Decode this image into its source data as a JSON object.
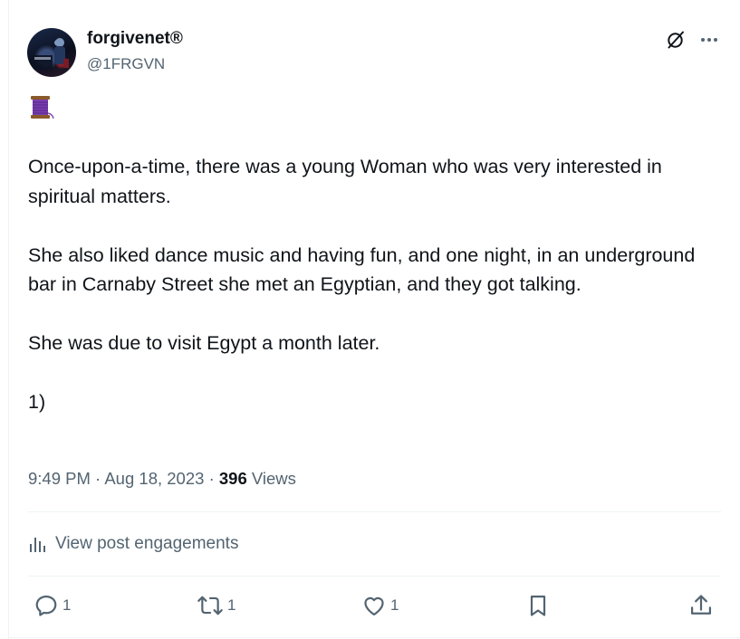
{
  "post": {
    "author": {
      "display_name": "forgivenet®",
      "handle": "@1FRGVN"
    },
    "emoji": "🧵",
    "paragraphs": [
      "Once-upon-a-time, there was a young Woman who was very interested in spiritual matters.",
      "She also liked dance music and having fun, and one night, in an underground bar in Carnaby Street she met an Egyptian, and they got talking.",
      "She was due to visit Egypt a month later.",
      "1)"
    ],
    "time": "9:49 PM",
    "separator": "·",
    "date": "Aug 18, 2023",
    "views_count": "396",
    "views_label": "Views",
    "engagements_label": "View post engagements",
    "actions": {
      "reply_count": "1",
      "repost_count": "1",
      "like_count": "1"
    }
  },
  "colors": {
    "text_primary": "#0f1419",
    "text_secondary": "#536471",
    "border": "#eff3f4"
  },
  "icons": [
    "grok-icon",
    "more-icon",
    "spool-emoji",
    "analytics-icon",
    "reply-icon",
    "repost-icon",
    "like-icon",
    "bookmark-icon",
    "share-icon"
  ]
}
